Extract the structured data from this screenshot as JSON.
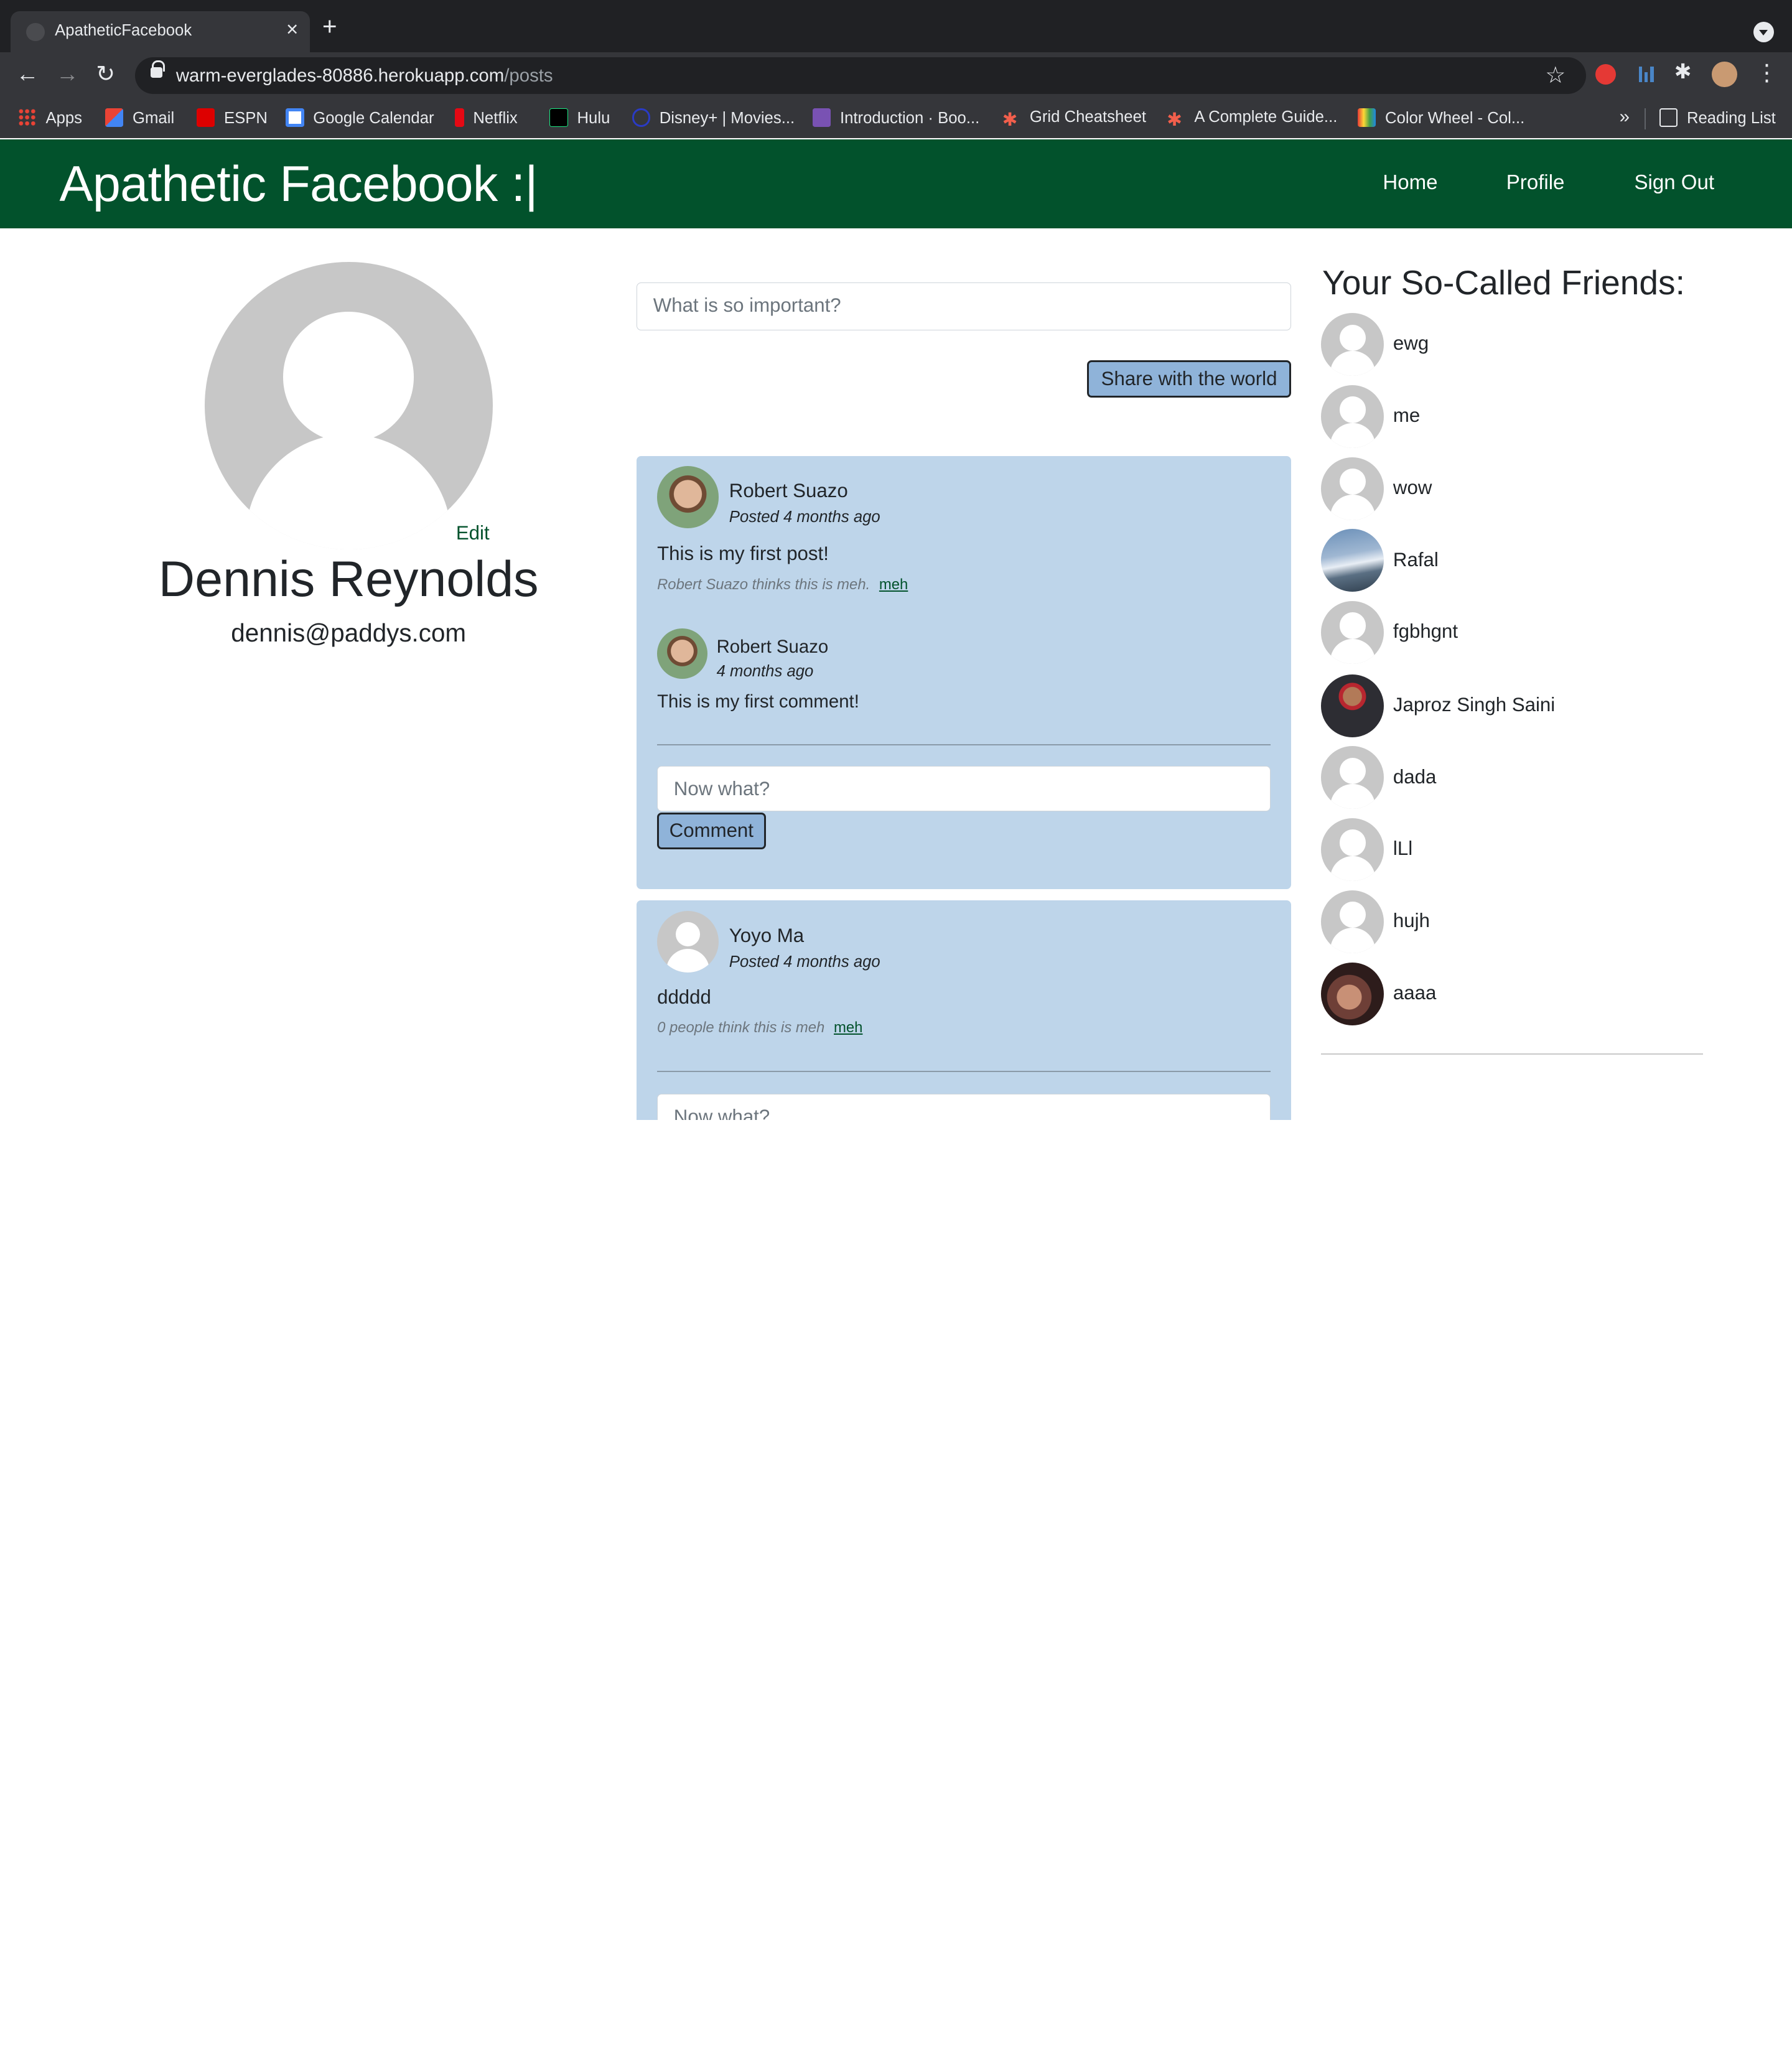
{
  "browser": {
    "tab_title": "ApatheticFacebook",
    "url_host": "warm-everglades-80886.herokuapp.com",
    "url_path": "/posts",
    "bookmarks": [
      {
        "label": "Apps",
        "icon": "apps-grid-icon"
      },
      {
        "label": "Gmail",
        "icon": "gmail-icon"
      },
      {
        "label": "ESPN",
        "icon": "espn-icon"
      },
      {
        "label": "Google Calendar",
        "icon": "calendar-icon"
      },
      {
        "label": "Netflix",
        "icon": "netflix-icon"
      },
      {
        "label": "Hulu",
        "icon": "hulu-icon"
      },
      {
        "label": "Disney+ | Movies...",
        "icon": "disney-icon"
      },
      {
        "label": "Introduction · Boo...",
        "icon": "bootstrap-icon"
      },
      {
        "label": "Grid Cheatsheet",
        "icon": "asterisk-icon"
      },
      {
        "label": "A Complete Guide...",
        "icon": "asterisk-icon"
      },
      {
        "label": "Color Wheel - Col...",
        "icon": "color-wheel-icon"
      }
    ],
    "more_bookmarks": "»",
    "reading_list": "Reading List"
  },
  "navbar": {
    "brand": "Apathetic Facebook :|",
    "links": [
      "Home",
      "Profile",
      "Sign Out"
    ],
    "color": "#02522c"
  },
  "profile": {
    "edit_label": "Edit",
    "name": "Dennis Reynolds",
    "email": "dennis@paddys.com"
  },
  "composer": {
    "placeholder": "What is so important?",
    "share_label": "Share with the world"
  },
  "posts": [
    {
      "author": "Robert Suazo",
      "meta": "Posted 4 months ago",
      "text": "This is my first post!",
      "meh_text": "Robert Suazo thinks this is meh.",
      "meh_link": "meh",
      "comments": [
        {
          "author": "Robert Suazo",
          "meta": "4 months ago",
          "text": "This is my first comment!"
        }
      ],
      "comment_placeholder": "Now what?",
      "comment_button": "Comment"
    },
    {
      "author": "Yoyo Ma",
      "meta": "Posted 4 months ago",
      "text": "ddddd",
      "meh_text": "0 people think this is meh",
      "meh_link": "meh",
      "comment_placeholder": "Now what?"
    }
  ],
  "friends": {
    "title": "Your So-Called Friends:",
    "list": [
      "ewg",
      "me",
      "wow",
      "Rafal",
      "fgbhgnt",
      "Japroz Singh Saini",
      "dada",
      "lLl",
      "hujh",
      "aaaa"
    ]
  },
  "colors": {
    "card_bg": "#bed5ea",
    "button_bg": "#8fb3d9"
  }
}
